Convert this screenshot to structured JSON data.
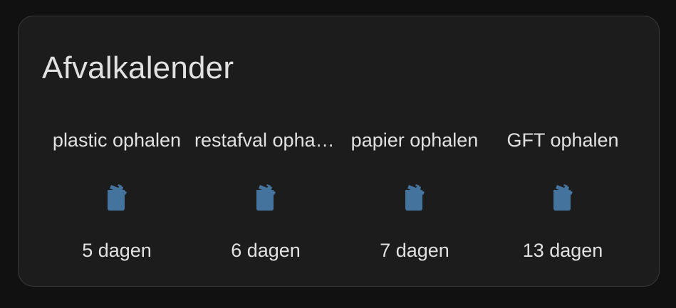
{
  "card": {
    "title": "Afvalkalender"
  },
  "colors": {
    "background": "#111111",
    "card_background": "#1c1c1c",
    "text": "#e1e1e1",
    "icon": "#44739e"
  },
  "entities": [
    {
      "name": "plastic ophalen",
      "icon": "trash-can-icon",
      "state": "5 dagen"
    },
    {
      "name": "restafval ophalen",
      "icon": "trash-can-icon",
      "state": "6 dagen"
    },
    {
      "name": "papier ophalen",
      "icon": "trash-can-icon",
      "state": "7 dagen"
    },
    {
      "name": "GFT ophalen",
      "icon": "trash-can-icon",
      "state": "13 dagen"
    }
  ]
}
